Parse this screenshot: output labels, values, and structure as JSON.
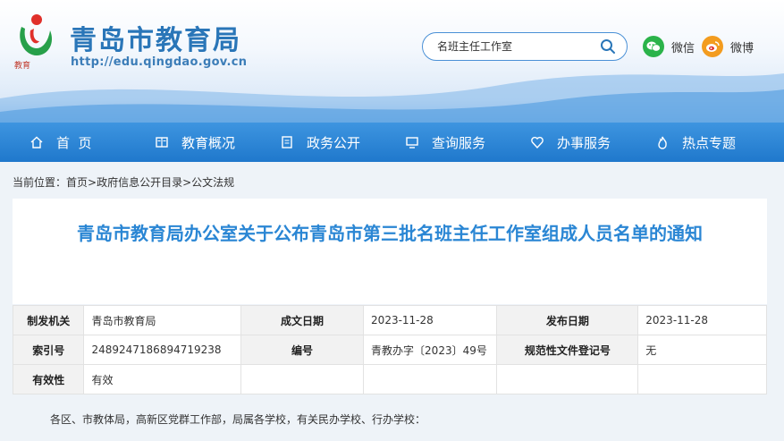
{
  "header": {
    "site_title": "青岛市教育局",
    "site_url": "http://edu.qingdao.gov.cn",
    "search": {
      "placeholder": "名班主任工作室"
    },
    "social": [
      {
        "label": "微信",
        "icon": "wechat-icon",
        "color": "#2bb34a"
      },
      {
        "label": "微博",
        "icon": "weibo-icon",
        "color": "#f39c1f"
      }
    ]
  },
  "nav": {
    "items": [
      {
        "label": "首  页",
        "icon": "home-icon"
      },
      {
        "label": "教育概况",
        "icon": "book-icon"
      },
      {
        "label": "政务公开",
        "icon": "document-icon"
      },
      {
        "label": "查询服务",
        "icon": "monitor-icon"
      },
      {
        "label": "办事服务",
        "icon": "heart-icon"
      },
      {
        "label": "热点专题",
        "icon": "fire-icon"
      }
    ]
  },
  "breadcrumb": {
    "prefix": "当前位置：",
    "items": [
      "首页",
      "政府信息公开目录",
      "公文法规"
    ],
    "separator": ">"
  },
  "article": {
    "title": "青岛市教育局办公室关于公布青岛市第三批名班主任工作室组成人员名单的通知",
    "meta": [
      [
        {
          "key": "制发机关",
          "value": "青岛市教育局"
        },
        {
          "key": "成文日期",
          "value": "2023-11-28"
        },
        {
          "key": "发布日期",
          "value": "2023-11-28"
        }
      ],
      [
        {
          "key": "索引号",
          "value": "2489247186894719238"
        },
        {
          "key": "编号",
          "value": "青教办字〔2023〕49号"
        },
        {
          "key": "规范性文件登记号",
          "value": "无"
        }
      ],
      [
        {
          "key": "有效性",
          "value": "有效"
        },
        {
          "key": "",
          "value": ""
        },
        {
          "key": "",
          "value": ""
        }
      ]
    ],
    "body_first_line": "各区、市教体局，高新区党群工作部，局属各学校，有关民办学校、行办学校："
  },
  "colors": {
    "brand_blue": "#2a76b8",
    "nav_blue": "#1f78cc",
    "title_blue": "#2a86d4"
  }
}
